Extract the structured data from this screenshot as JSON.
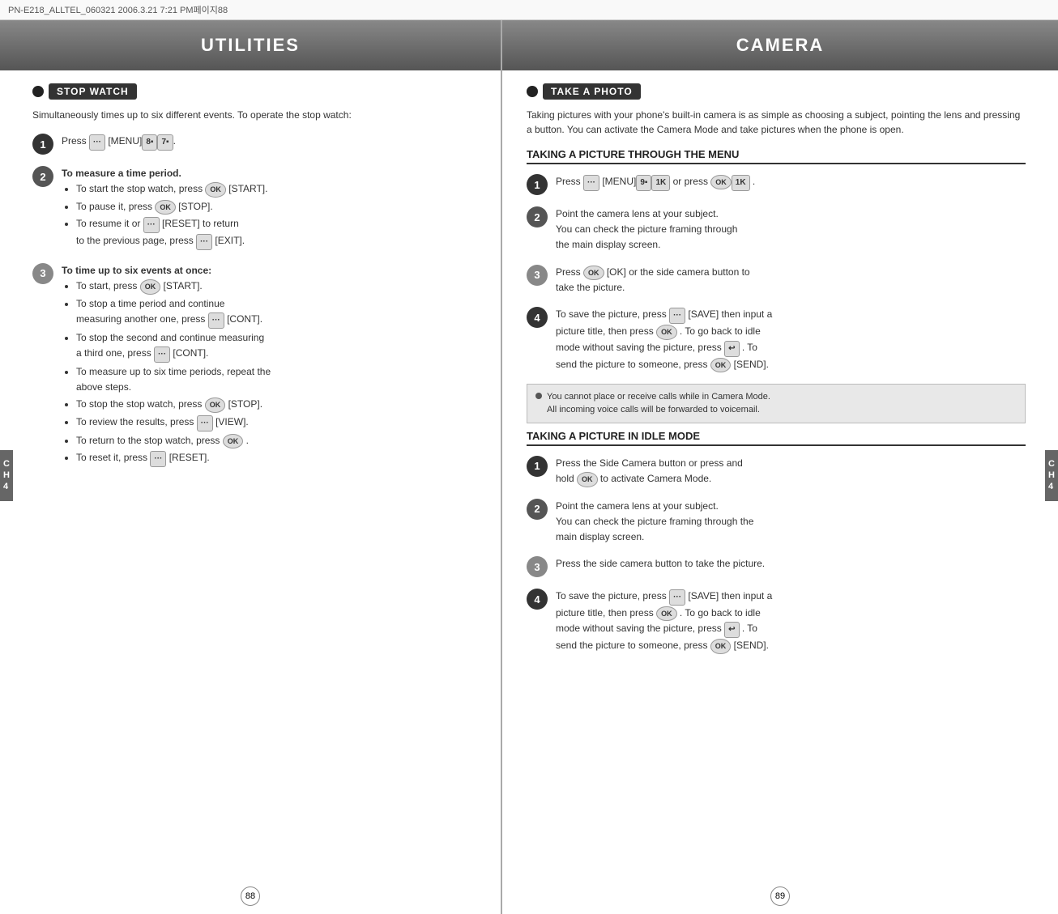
{
  "meta": {
    "filename": "PN-E218_ALLTEL_060321  2006.3.21 7:21 PM페이지88"
  },
  "left": {
    "header": "UTILITIES",
    "topic_label": "STOP WATCH",
    "intro": "Simultaneously times up to six different events. To operate the stop watch:",
    "steps": [
      {
        "num": "1",
        "text": "Press [MENU]."
      },
      {
        "num": "2",
        "heading": "To measure a time period.",
        "items": [
          "To start the stop watch, press OK [START].",
          "To pause it, press OK [STOP].",
          "To resume it or [RESET] to return to the previous page, press [EXIT]."
        ]
      },
      {
        "num": "3",
        "heading": "To time up to six events at once:",
        "items": [
          "To start, press OK [START].",
          "To stop a time period and continue measuring another one, press [CONT].",
          "To stop the second and continue measuring a third one, press [CONT].",
          "To measure up to six time periods, repeat the above steps.",
          "To stop the stop watch, press OK [STOP].",
          "To review the results, press [VIEW].",
          "To return to the stop watch, press OK .",
          "To reset it, press [RESET]."
        ]
      }
    ],
    "page_num": "88"
  },
  "right": {
    "header": "CAMERA",
    "topic_label": "TAKE A PHOTO",
    "intro": "Taking pictures with your phone's built-in camera is as simple as choosing a subject, pointing the lens and pressing a button. You can activate the Camera Mode and take pictures when the phone is open.",
    "section1_heading": "TAKING A PICTURE THROUGH THE MENU",
    "section1_steps": [
      {
        "num": "1",
        "text": "Press [MENU] or press OK ."
      },
      {
        "num": "2",
        "text": "Point the camera lens at your subject. You can check the picture framing through the main display screen."
      },
      {
        "num": "3",
        "text": "Press OK [OK] or the side camera button to take the picture."
      },
      {
        "num": "4",
        "text": "To save the picture, press [SAVE] then input a picture title, then press OK . To go back to idle mode without saving the picture, press  . To send the picture to someone, press OK [SEND]."
      }
    ],
    "note": {
      "line1": "You cannot place or receive calls while in Camera Mode.",
      "line2": "All incoming voice calls will be forwarded to voicemail."
    },
    "section2_heading": "TAKING A PICTURE IN IDLE MODE",
    "section2_steps": [
      {
        "num": "1",
        "text": "Press the Side Camera button or press and hold OK to activate Camera Mode."
      },
      {
        "num": "2",
        "text": "Point the camera lens at your subject. You can check the picture framing through the main display screen."
      },
      {
        "num": "3",
        "text": "Press the side camera button to take the picture."
      },
      {
        "num": "4",
        "text": "To save the picture, press [SAVE] then input a picture title, then press OK . To go back to idle mode without saving the picture, press  . To send the picture to someone, press OK [SEND]."
      }
    ],
    "page_num": "89",
    "ch_tab": "CH\n4"
  }
}
